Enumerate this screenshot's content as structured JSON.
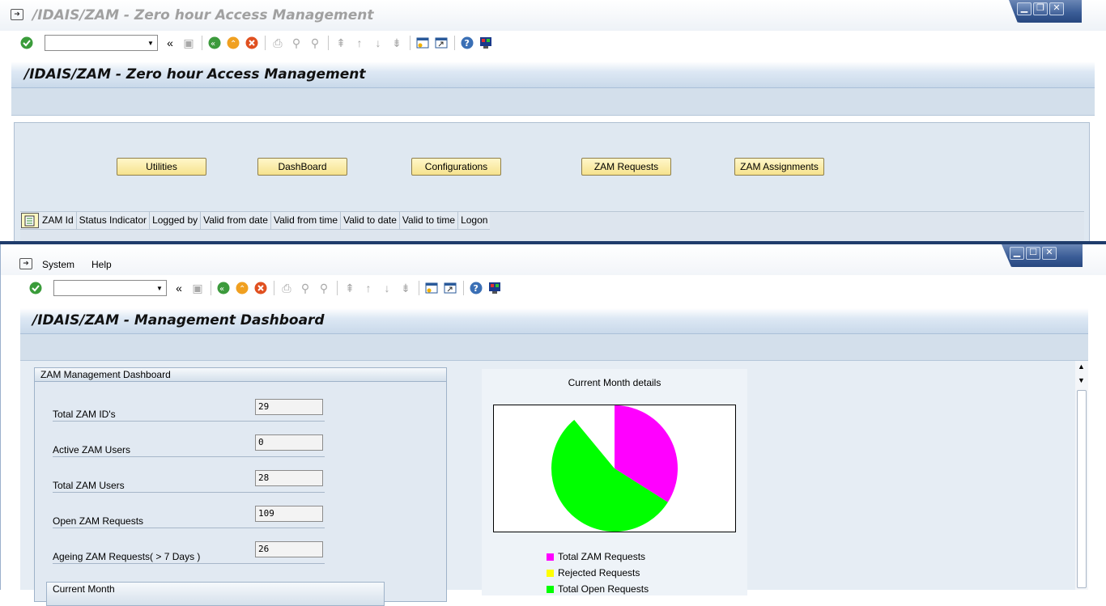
{
  "window1": {
    "title": "/IDAIS/ZAM - Zero hour Access Management",
    "screen_title": "/IDAIS/ZAM - Zero hour Access Management",
    "buttons": [
      "Utilities",
      "DashBoard",
      "Configurations",
      "ZAM Requests",
      "ZAM Assignments"
    ],
    "table_columns": [
      "ZAM Id",
      "Status Indicator",
      "Logged by",
      "Valid from date",
      "Valid from time",
      "Valid to date",
      "Valid to time",
      "Logon"
    ]
  },
  "window2": {
    "menu": [
      "System",
      "Help"
    ],
    "screen_title": "/IDAIS/ZAM - Management Dashboard",
    "group_title": "ZAM Management Dashboard",
    "fields": [
      {
        "label": "Total ZAM ID's",
        "value": "29"
      },
      {
        "label": "Active ZAM Users",
        "value": "0"
      },
      {
        "label": "Total ZAM Users",
        "value": "28"
      },
      {
        "label": "Open ZAM Requests",
        "value": "109"
      },
      {
        "label": "Ageing ZAM Requests( > 7 Days )",
        "value": "26"
      }
    ],
    "group2_title": "Current Month"
  },
  "chart_data": {
    "type": "pie",
    "title": "Current Month details",
    "series": [
      {
        "name": "Total ZAM Requests",
        "value": 34,
        "color": "#ff00ff"
      },
      {
        "name": "Rejected Requests",
        "value": 0,
        "color": "#ffff00"
      },
      {
        "name": "Total Open Requests",
        "value": 55,
        "color": "#00ff00"
      },
      {
        "name": "",
        "value": 11,
        "color": "#ffffff"
      }
    ]
  }
}
